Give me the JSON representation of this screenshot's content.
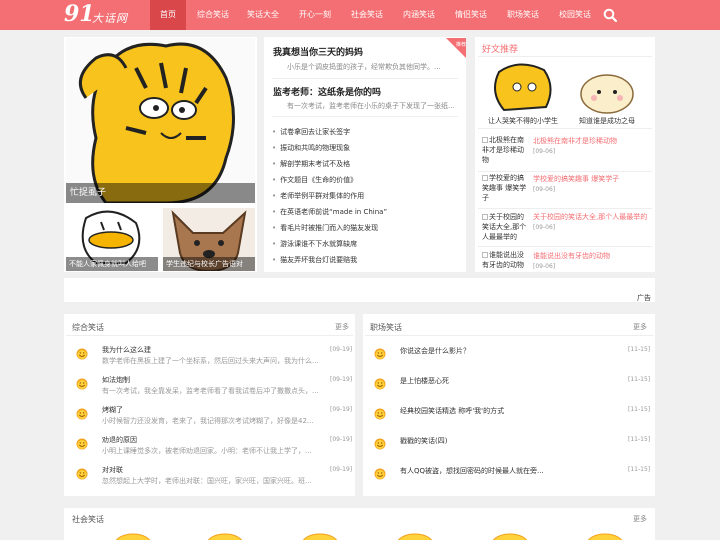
{
  "header": {
    "logo_number": "91",
    "logo_text": "大话网",
    "nav": [
      "首页",
      "综合笑话",
      "笑话大全",
      "开心一刻",
      "社会笑话",
      "内涵笑话",
      "情侣笑话",
      "职场笑话",
      "校园笑话"
    ]
  },
  "hero": {
    "caption": "忙捉虱子"
  },
  "thumbs": [
    {
      "caption": "不能人家佩身就叫人给吧"
    },
    {
      "caption": "学生违纪与校长广告语对"
    }
  ],
  "featured": [
    {
      "title": "我真想当你三天的妈妈",
      "summary": "小乐是个调皮捣蛋的孩子，经常欺负其他同学。..."
    },
    {
      "title": "监考老师：这纸条是你的吗",
      "summary": "有一次考试，监考老师在小乐的桌子下发现了一张纸..."
    }
  ],
  "badge": "推荐",
  "list": [
    "试卷拿回去让家长签字",
    "振动和共鸣的物理现象",
    "解剖学期末考试不及格",
    "作文题目《生命的价值》",
    "老师举例平群对集体的作用",
    "在英语老师前说“made in China”",
    "看毛片时被推门而入的猫友发现",
    "游泳课谁不下水就算缺席",
    "猫友弄坏我台灯说要赔我"
  ],
  "recommend": {
    "title": "好文推荐",
    "top": [
      {
        "caption": "让人哭笑不得的小学生"
      },
      {
        "caption": "知道谁是成功之母"
      }
    ],
    "items": [
      {
        "thumb": "北极熊在南非才是珍稀动物",
        "link": "北极熊在南非才是珍稀动物",
        "date": "[09-06]"
      },
      {
        "thumb": "学校爱的搞笑趣事 爆笑学子",
        "link": "学校爱的搞笑趣事 爆笑学子",
        "date": "[09-06]"
      },
      {
        "thumb": "关于校园的笑话大全,那个人最最举的",
        "link": "关于校园的笑话大全,那个人最最举的",
        "date": "[09-06]"
      },
      {
        "thumb": "谁能说出没有牙齿的动物",
        "link": "谁能说出没有牙齿的动物",
        "date": "[09-06]"
      }
    ]
  },
  "ad_label": "广告",
  "sections": {
    "zonghe": {
      "title": "综合笑话",
      "more": "更多",
      "rows": [
        {
          "title": "我为什么这么建",
          "summary": "数学老师在黑板上建了一个坐标系，然后回过头来大声问，我为什么...",
          "date": "[09-19]"
        },
        {
          "title": "如法炮制",
          "summary": "有一次考试，我全靠发呆，监考老师看了看我试卷后冲了撒撒点头，...",
          "date": "[09-19]"
        },
        {
          "title": "烤糊了",
          "summary": "小时候智力还没发育，老来了，我记得那次考试烤糊了，好像是42...",
          "date": "[09-19]"
        },
        {
          "title": "劝退的原因",
          "summary": "小明上课睡觉多次，被老师劝退回家。小明：老师不让我上学了，...",
          "date": "[09-19]"
        },
        {
          "title": "对对联",
          "summary": "忽然想起上大学时，老师出对联：国兴旺，家兴旺，国家兴旺。班...",
          "date": "[09-19]"
        }
      ]
    },
    "zhichang": {
      "title": "职场笑话",
      "more": "更多",
      "rows": [
        {
          "title": "你说这会是什么影片？",
          "date": "[11-15]"
        },
        {
          "title": "是上怕楼恶心死",
          "date": "[11-15]"
        },
        {
          "title": "经典校园笑话精选 称呼'我'的方式",
          "date": "[11-15]"
        },
        {
          "title": "戳戳的笑话(四)",
          "date": "[11-15]"
        },
        {
          "title": "有人QQ被盗，想找回密码的时候最人就在旁...",
          "date": "[11-15]"
        }
      ]
    },
    "shehui": {
      "title": "社会笑话",
      "more": "更多"
    }
  },
  "colors": {
    "brand": "#f46f73",
    "nav_active": "#d9474b",
    "link": "#f46f73"
  }
}
